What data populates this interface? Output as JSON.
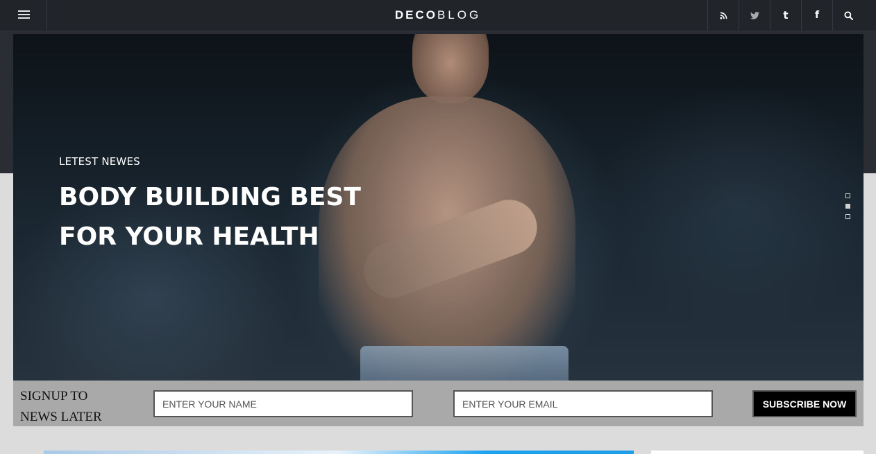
{
  "header": {
    "logo_bold": "DECO",
    "logo_thin": "BLOG",
    "icons": [
      "menu-icon",
      "rss-icon",
      "twitter-icon",
      "tumblr-icon",
      "facebook-icon",
      "search-icon"
    ],
    "tumblr_glyph": "t",
    "facebook_glyph": "f"
  },
  "hero": {
    "kicker": "LETEST NEWES",
    "title_line1": "BODY BUILDING BEST",
    "title_line2": "FOR YOUR HEALTH",
    "slides": 3,
    "active_slide": 2
  },
  "signup": {
    "label_line1": "SIGNUP TO",
    "label_line2": "NEWS LATER",
    "name_placeholder": "ENTER YOUR NAME",
    "email_placeholder": "ENTER YOUR EMAIL",
    "button_label": "SUBSCRIBE NOW"
  },
  "colors": {
    "header_bg": "#212429",
    "band_bg": "#2a2d33",
    "page_bg": "#dcdcdc",
    "signup_bg": "#a9a9a9",
    "button_bg": "#000000"
  }
}
